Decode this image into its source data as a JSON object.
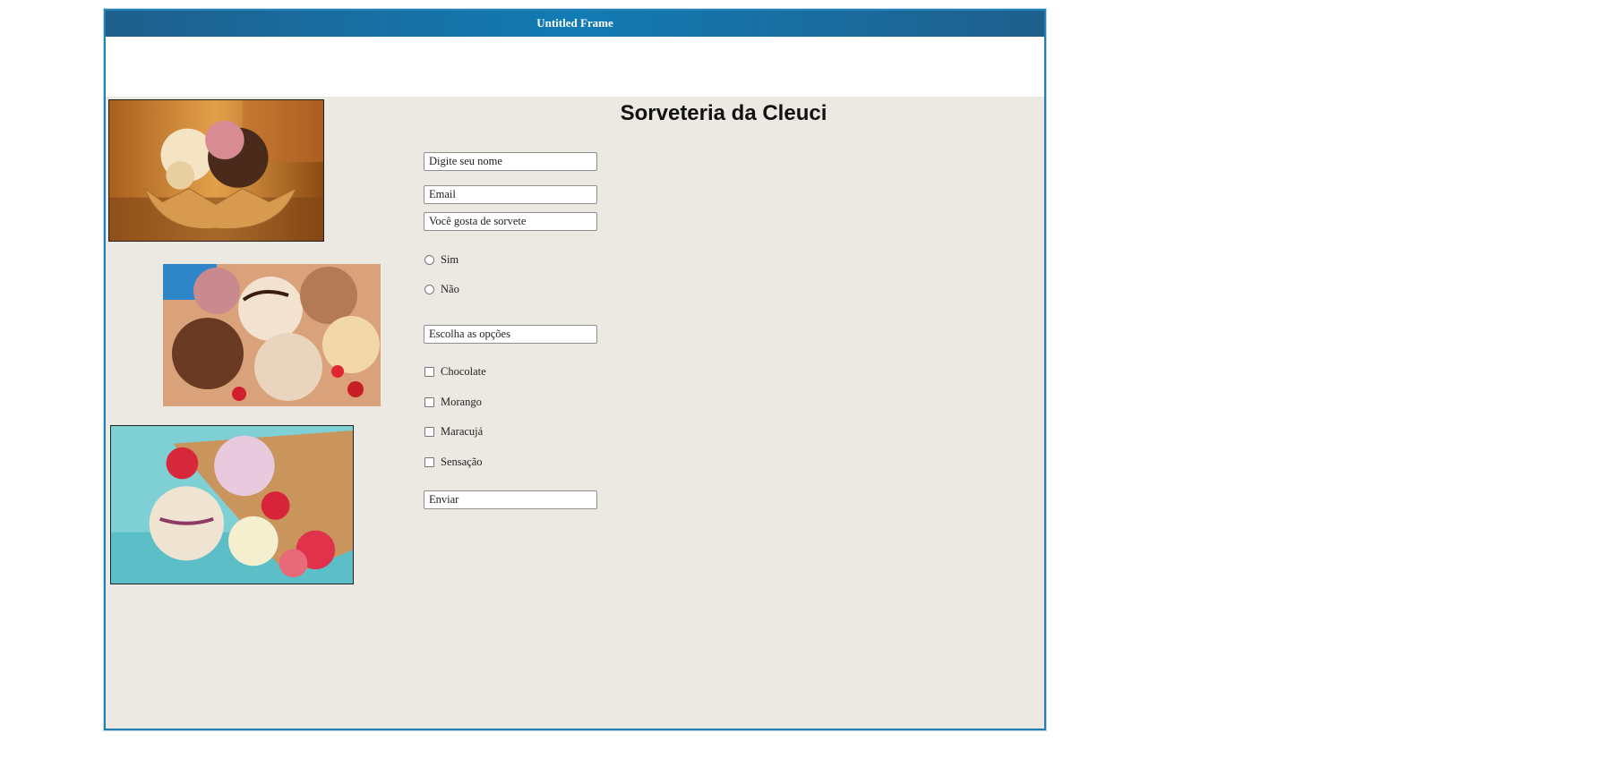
{
  "window": {
    "title": "Untitled Frame"
  },
  "page": {
    "heading": "Sorveteria da Cleuci"
  },
  "form": {
    "name_placeholder": "Digite seu nome",
    "email_placeholder": "Email",
    "question_placeholder": "Você gosta de sorvete",
    "radio_options": [
      "Sim",
      "Não"
    ],
    "choices_placeholder": "Escolha as opções",
    "checkbox_options": [
      "Chocolate",
      "Morango",
      "Maracujá",
      "Sensação"
    ],
    "submit_label": "Enviar"
  },
  "colors": {
    "titlebar": "#137bb4",
    "frame_border": "#2180b6",
    "background": "#ece9e3"
  }
}
